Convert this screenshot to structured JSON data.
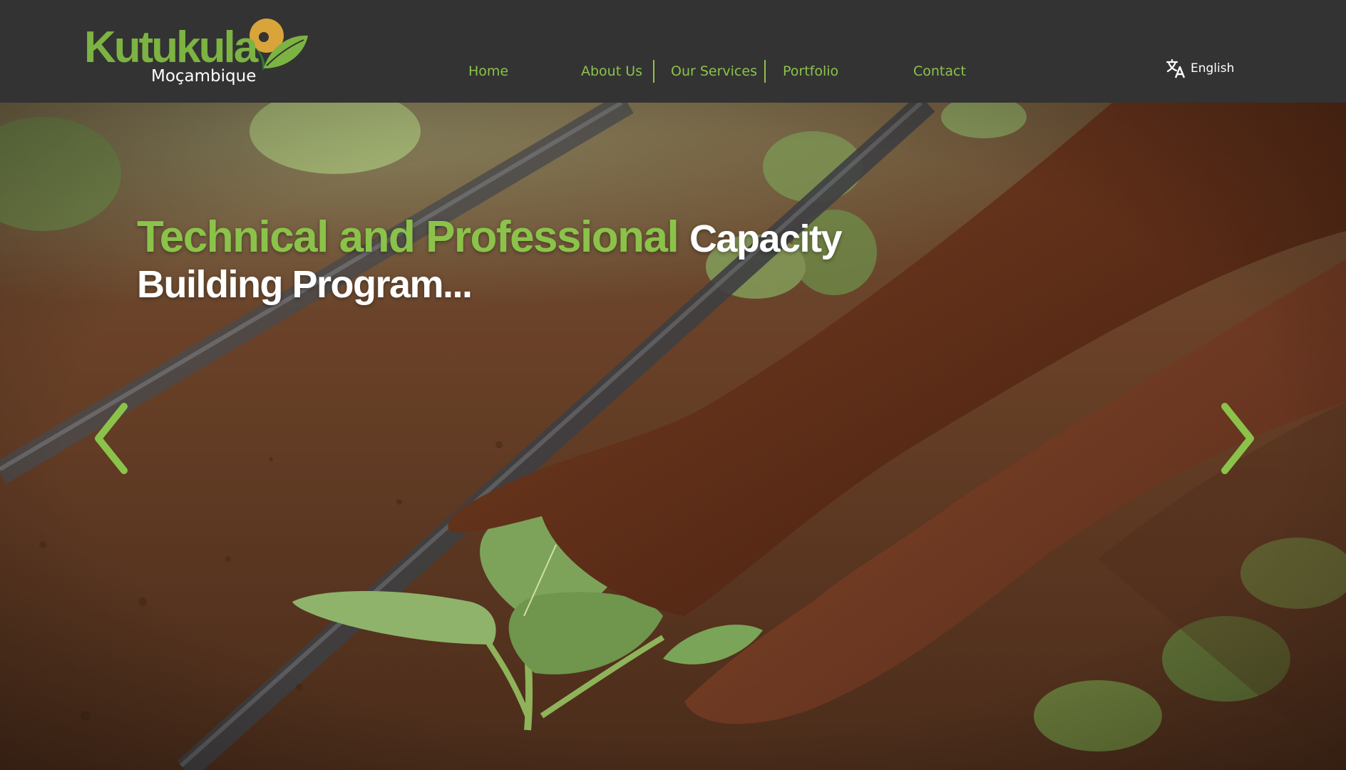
{
  "brand": {
    "name": "Kutukula",
    "subtitle": "Moçambique",
    "primary_color": "#8bc34a",
    "logo_sun_color": "#d9a43a"
  },
  "nav": {
    "items": [
      {
        "label": "Home"
      },
      {
        "label": "About Us"
      },
      {
        "label": "Our Services"
      },
      {
        "label": "Portfolio"
      },
      {
        "label": "Contact"
      }
    ]
  },
  "language": {
    "icon": "translate-icon",
    "label": "English"
  },
  "hero": {
    "headline_green": "Technical and Professional",
    "headline_white": "Capacity",
    "headline_line2": "Building Program...",
    "prev_icon": "chevron-left-icon",
    "next_icon": "chevron-right-icon",
    "image_subject": "hands planting seedling in soil"
  }
}
